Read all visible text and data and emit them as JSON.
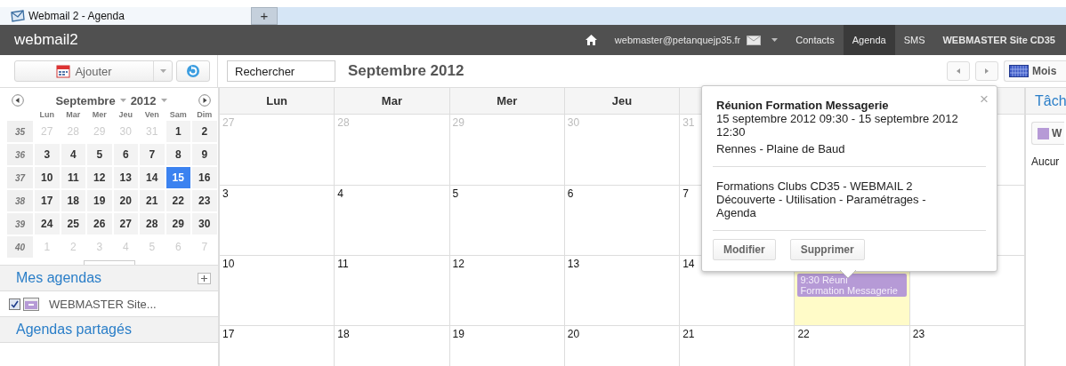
{
  "browser_tab": {
    "title": "Webmail 2 - Agenda",
    "new_tab": "+"
  },
  "header": {
    "app_name": "webmail2",
    "account": "webmaster@petanquejp35.fr",
    "nav": [
      {
        "label": "Contacts",
        "selected": false
      },
      {
        "label": "Agenda",
        "selected": true
      },
      {
        "label": "SMS",
        "selected": false
      }
    ],
    "user_name": "WEBMASTER Site CD35"
  },
  "toolbar": {
    "add_button": "Ajouter",
    "search": {
      "value": "Rechercher"
    },
    "period_title": "Septembre 2012",
    "view_button": "Mois"
  },
  "mini_calendar": {
    "month": "Septembre",
    "year": "2012",
    "weekdays": [
      "Lun",
      "Mar",
      "Mer",
      "Jeu",
      "Ven",
      "Sam",
      "Dim"
    ],
    "weeks": [
      {
        "week": "35",
        "days": [
          {
            "label": "27",
            "other_month": true,
            "selected": false
          },
          {
            "label": "28",
            "other_month": true,
            "selected": false
          },
          {
            "label": "29",
            "other_month": true,
            "selected": false
          },
          {
            "label": "30",
            "other_month": true,
            "selected": false
          },
          {
            "label": "31",
            "other_month": true,
            "selected": false
          },
          {
            "label": "1",
            "other_month": false,
            "selected": false
          },
          {
            "label": "2",
            "other_month": false,
            "selected": false
          }
        ]
      },
      {
        "week": "36",
        "days": [
          {
            "label": "3",
            "other_month": false,
            "selected": false
          },
          {
            "label": "4",
            "other_month": false,
            "selected": false
          },
          {
            "label": "5",
            "other_month": false,
            "selected": false
          },
          {
            "label": "6",
            "other_month": false,
            "selected": false
          },
          {
            "label": "7",
            "other_month": false,
            "selected": false
          },
          {
            "label": "8",
            "other_month": false,
            "selected": false
          },
          {
            "label": "9",
            "other_month": false,
            "selected": false
          }
        ]
      },
      {
        "week": "37",
        "days": [
          {
            "label": "10",
            "other_month": false,
            "selected": false
          },
          {
            "label": "11",
            "other_month": false,
            "selected": false
          },
          {
            "label": "12",
            "other_month": false,
            "selected": false
          },
          {
            "label": "13",
            "other_month": false,
            "selected": false
          },
          {
            "label": "14",
            "other_month": false,
            "selected": false
          },
          {
            "label": "15",
            "other_month": false,
            "selected": true
          },
          {
            "label": "16",
            "other_month": false,
            "selected": false
          }
        ]
      },
      {
        "week": "38",
        "days": [
          {
            "label": "17",
            "other_month": false,
            "selected": false
          },
          {
            "label": "18",
            "other_month": false,
            "selected": false
          },
          {
            "label": "19",
            "other_month": false,
            "selected": false
          },
          {
            "label": "20",
            "other_month": false,
            "selected": false
          },
          {
            "label": "21",
            "other_month": false,
            "selected": false
          },
          {
            "label": "22",
            "other_month": false,
            "selected": false
          },
          {
            "label": "23",
            "other_month": false,
            "selected": false
          }
        ]
      },
      {
        "week": "39",
        "days": [
          {
            "label": "24",
            "other_month": false,
            "selected": false
          },
          {
            "label": "25",
            "other_month": false,
            "selected": false
          },
          {
            "label": "26",
            "other_month": false,
            "selected": false
          },
          {
            "label": "27",
            "other_month": false,
            "selected": false
          },
          {
            "label": "28",
            "other_month": false,
            "selected": false
          },
          {
            "label": "29",
            "other_month": false,
            "selected": false
          },
          {
            "label": "30",
            "other_month": false,
            "selected": false
          }
        ]
      },
      {
        "week": "40",
        "days": [
          {
            "label": "1",
            "other_month": true,
            "selected": false
          },
          {
            "label": "2",
            "other_month": true,
            "selected": false
          },
          {
            "label": "3",
            "other_month": true,
            "selected": false
          },
          {
            "label": "4",
            "other_month": true,
            "selected": false
          },
          {
            "label": "5",
            "other_month": true,
            "selected": false
          },
          {
            "label": "6",
            "other_month": true,
            "selected": false
          },
          {
            "label": "7",
            "other_month": true,
            "selected": false
          }
        ]
      }
    ]
  },
  "my_calendars": {
    "title": "Mes agendas",
    "items": [
      {
        "label": "WEBMASTER Site...",
        "checked": true,
        "color": "#b69ad6"
      }
    ]
  },
  "shared_calendars": {
    "title": "Agendas partagés"
  },
  "month_grid": {
    "columns": [
      "Lun",
      "Mar",
      "Mer",
      "Jeu"
    ],
    "weeks": [
      [
        {
          "label": "27",
          "other_month": true
        },
        {
          "label": "28",
          "other_month": true
        },
        {
          "label": "29",
          "other_month": true
        },
        {
          "label": "30",
          "other_month": true
        },
        {
          "label": "31",
          "other_month": true
        }
      ],
      [
        {
          "label": "3"
        },
        {
          "label": "4"
        },
        {
          "label": "5"
        },
        {
          "label": "6"
        },
        {
          "label": "7"
        }
      ],
      [
        {
          "label": "10"
        },
        {
          "label": "11"
        },
        {
          "label": "12"
        },
        {
          "label": "13"
        },
        {
          "label": "14"
        },
        {
          "today": true,
          "events": [
            {
              "lines": [
                "9:30 Réuni",
                "Formation Messagerie"
              ],
              "color": "#b69ad6"
            }
          ]
        }
      ],
      [
        {
          "label": "17"
        },
        {
          "label": "18"
        },
        {
          "label": "19"
        },
        {
          "label": "20"
        },
        {
          "label": "21"
        },
        {
          "label": "22"
        },
        {
          "label": "23"
        }
      ]
    ]
  },
  "event_popup": {
    "title": "Réunion Formation Messagerie",
    "when": "15 septembre 2012 09:30 - 15 septembre 2012 12:30",
    "location": "Rennes - Plaine de Baud",
    "description": "Formations Clubs CD35 - WEBMAIL 2 Découverte - Utilisation - Paramétrages - Agenda",
    "buttons": [
      "Modifier",
      "Supprimer"
    ],
    "close": "×"
  },
  "tasks_panel": {
    "title": "Tâch",
    "filter_button": "W",
    "empty_text": "Aucur"
  }
}
